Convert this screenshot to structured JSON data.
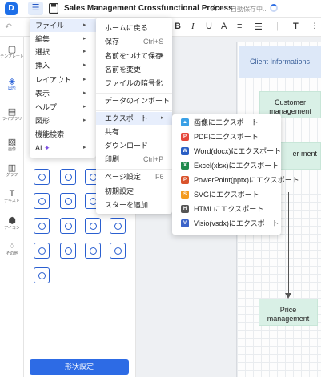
{
  "header": {
    "logo_letter": "D",
    "menu_icon": "hamburger-icon",
    "title": "Sales Management Crossfunctional Process",
    "autosave_text": "自動保存中..."
  },
  "toolbar": {
    "icons": [
      "undo-icon",
      "bold-icon",
      "italic-icon",
      "underline-icon",
      "font-color-icon",
      "align-icon",
      "list-icon",
      "text-tool-icon"
    ]
  },
  "rail": {
    "items": [
      {
        "label": "テンプレート",
        "icon": "template-icon",
        "active": false
      },
      {
        "label": "図形",
        "icon": "shapes-icon",
        "active": true
      },
      {
        "label": "ライブラリ",
        "icon": "library-icon",
        "active": false
      },
      {
        "label": "画像",
        "icon": "image-icon",
        "active": false
      },
      {
        "label": "グラフ",
        "icon": "chart-icon",
        "active": false
      },
      {
        "label": "テキスト",
        "icon": "text-icon",
        "active": false
      },
      {
        "label": "アイコン",
        "icon": "icon-icon",
        "active": false
      },
      {
        "label": "その他",
        "icon": "more-icon",
        "active": false
      }
    ]
  },
  "panel": {
    "button_label": "形状設定"
  },
  "menu_main": {
    "items": [
      {
        "label": "ファイル",
        "arrow": true,
        "highlighted": true
      },
      {
        "label": "編集",
        "arrow": true
      },
      {
        "label": "選択",
        "arrow": true
      },
      {
        "label": "挿入",
        "arrow": true
      },
      {
        "label": "レイアウト",
        "arrow": true
      },
      {
        "label": "表示",
        "arrow": true
      },
      {
        "label": "ヘルプ",
        "arrow": true
      },
      {
        "label": "図形",
        "arrow": true
      },
      {
        "label": "機能検索",
        "arrow": false
      },
      {
        "label": "AI",
        "arrow": true
      }
    ]
  },
  "menu_file": {
    "items": [
      {
        "label": "ホームに戻る"
      },
      {
        "label": "保存",
        "shortcut": "Ctrl+S"
      },
      {
        "label": "名前をつけて保存",
        "arrow": true
      },
      {
        "label": "名前を変更"
      },
      {
        "label": "ファイルの暗号化"
      },
      {
        "label": "データのインポート"
      },
      {
        "label": "エクスポート",
        "arrow": true,
        "highlighted": true
      },
      {
        "label": "共有"
      },
      {
        "label": "ダウンロード"
      },
      {
        "label": "印刷",
        "shortcut": "Ctrl+P"
      },
      {
        "label": "ページ設定",
        "shortcut": "F6"
      },
      {
        "label": "初期設定"
      },
      {
        "label": "スターを追加"
      }
    ]
  },
  "menu_export": {
    "items": [
      {
        "label": "画像にエクスポート",
        "icon": "image-file-icon",
        "color": "#3aa0e6",
        "glyph": "▲"
      },
      {
        "label": "PDFにエクスポート",
        "icon": "pdf-file-icon",
        "color": "#e5473b",
        "glyph": "P"
      },
      {
        "label": "Word(docx)にエクスポート",
        "icon": "word-file-icon",
        "color": "#2b5fc4",
        "glyph": "W"
      },
      {
        "label": "Excel(xlsx)にエクスポート",
        "icon": "excel-file-icon",
        "color": "#1f8a4c",
        "glyph": "X"
      },
      {
        "label": "PowerPoint(pptx)にエクスポート",
        "icon": "powerpoint-file-icon",
        "color": "#d9532c",
        "glyph": "P"
      },
      {
        "label": "SVGにエクスポート",
        "icon": "svg-file-icon",
        "color": "#f39a1e",
        "glyph": "S"
      },
      {
        "label": "HTMLにエクスポート",
        "icon": "html-file-icon",
        "color": "#555555",
        "glyph": "H"
      },
      {
        "label": "Visio(vsdx)にエクスポート",
        "icon": "visio-file-icon",
        "color": "#3b63c9",
        "glyph": "V"
      }
    ]
  },
  "canvas": {
    "lane_label": "Client Informations",
    "node_customer": "Customer management",
    "node_middle": "er ment",
    "node_price": "Price management"
  }
}
